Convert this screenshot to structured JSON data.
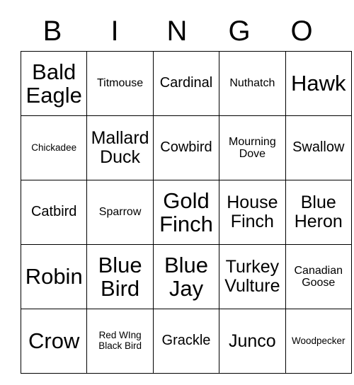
{
  "header": {
    "letters": [
      "B",
      "I",
      "N",
      "G",
      "O"
    ]
  },
  "grid": {
    "rows": [
      [
        {
          "text": "Bald Eagle",
          "size": "fs-xl"
        },
        {
          "text": "Titmouse",
          "size": "fs-sm"
        },
        {
          "text": "Cardinal",
          "size": "fs-md"
        },
        {
          "text": "Nuthatch",
          "size": "fs-sm"
        },
        {
          "text": "Hawk",
          "size": "fs-xl"
        }
      ],
      [
        {
          "text": "Chickadee",
          "size": "fs-xs"
        },
        {
          "text": "Mallard Duck",
          "size": "fs-lg"
        },
        {
          "text": "Cowbird",
          "size": "fs-md"
        },
        {
          "text": "Mourning Dove",
          "size": "fs-sm"
        },
        {
          "text": "Swallow",
          "size": "fs-md"
        }
      ],
      [
        {
          "text": "Catbird",
          "size": "fs-md"
        },
        {
          "text": "Sparrow",
          "size": "fs-sm"
        },
        {
          "text": "Gold Finch",
          "size": "fs-xl"
        },
        {
          "text": "House Finch",
          "size": "fs-lg"
        },
        {
          "text": "Blue Heron",
          "size": "fs-lg"
        }
      ],
      [
        {
          "text": "Robin",
          "size": "fs-xl"
        },
        {
          "text": "Blue Bird",
          "size": "fs-xl"
        },
        {
          "text": "Blue Jay",
          "size": "fs-xl"
        },
        {
          "text": "Turkey Vulture",
          "size": "fs-lg"
        },
        {
          "text": "Canadian Goose",
          "size": "fs-sm"
        }
      ],
      [
        {
          "text": "Crow",
          "size": "fs-xl"
        },
        {
          "text": "Red WIng Black Bird",
          "size": "fs-xs"
        },
        {
          "text": "Grackle",
          "size": "fs-md"
        },
        {
          "text": "Junco",
          "size": "fs-lg"
        },
        {
          "text": "Woodpecker",
          "size": "fs-xs"
        }
      ]
    ]
  }
}
